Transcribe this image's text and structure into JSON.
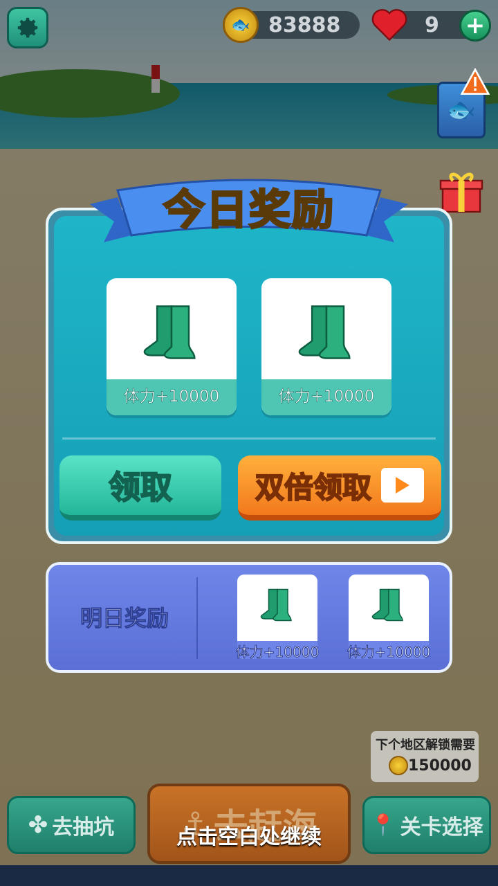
{
  "resources": {
    "coins": "83888",
    "lives": "9"
  },
  "daily_reward": {
    "title": "今日奖励",
    "items": [
      {
        "icon": "green-boots-icon",
        "label": "体力+10000"
      },
      {
        "icon": "green-boots-icon",
        "label": "体力+10000"
      }
    ],
    "claim_label": "领取",
    "double_claim_label": "双倍领取"
  },
  "tomorrow_reward": {
    "title": "明日奖励",
    "items": [
      {
        "icon": "green-boots-icon",
        "label": "体力+10000"
      },
      {
        "icon": "green-boots-icon",
        "label": "体力+10000"
      }
    ]
  },
  "unlock": {
    "text": "下个地区解锁需要",
    "cost": "150000"
  },
  "bottom_nav": {
    "lottery": "去抽坑",
    "go_sea": "去赶海",
    "level_select": "关卡选择"
  },
  "continue_hint": "点击空白处继续",
  "colors": {
    "panel": "#1fb5c8",
    "claim": "#24b69a",
    "double_claim": "#f3791c",
    "tomorrow_panel": "#6f86e8",
    "title": "#ffe83a"
  }
}
